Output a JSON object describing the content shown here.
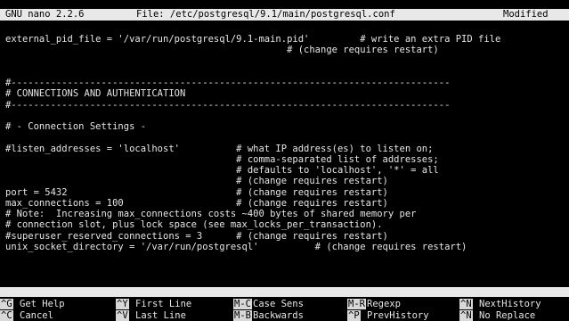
{
  "titlebar": {
    "app": "GNU nano 2.2.6",
    "file": "File: /etc/postgresql/9.1/main/postgresql.conf",
    "status": "Modified"
  },
  "editor": {
    "lines": [
      "external_pid_file = '/var/run/postgresql/9.1-main.pid'         # write an extra PID file",
      "                                                  # (change requires restart)",
      "",
      "",
      "#------------------------------------------------------------------------------",
      "# CONNECTIONS AND AUTHENTICATION",
      "#------------------------------------------------------------------------------",
      "",
      "# - Connection Settings -",
      "",
      "#listen_addresses = 'localhost'          # what IP address(es) to listen on;",
      "                                         # comma-separated list of addresses;",
      "                                         # defaults to 'localhost', '*' = all",
      "                                         # (change requires restart)",
      "port = 5432                              # (change requires restart)",
      "max_connections = 100                    # (change requires restart)",
      "# Note:  Increasing max_connections costs ~400 bytes of shared memory per",
      "# connection slot, plus lock space (see max_locks_per_transaction).",
      "#superuser_reserved_connections = 3      # (change requires restart)",
      "unix_socket_directory = '/var/run/postgresql'          # (change requires restart)"
    ]
  },
  "prompt": {
    "text": "Search (to replace) [listen_]: _"
  },
  "shortcuts": {
    "row1": [
      {
        "key": "^G",
        "label": "Get Help"
      },
      {
        "key": "^Y",
        "label": "First Line"
      },
      {
        "key": "M-C",
        "label": "Case Sens"
      },
      {
        "key": "M-R",
        "label": "Regexp"
      },
      {
        "key": "^N",
        "label": "NextHistory"
      }
    ],
    "row2": [
      {
        "key": "^C",
        "label": "Cancel"
      },
      {
        "key": "^V",
        "label": "Last Line"
      },
      {
        "key": "M-B",
        "label": "Backwards"
      },
      {
        "key": "^P",
        "label": "PrevHistory"
      },
      {
        "key": "^N",
        "label": "No Replace"
      }
    ]
  }
}
